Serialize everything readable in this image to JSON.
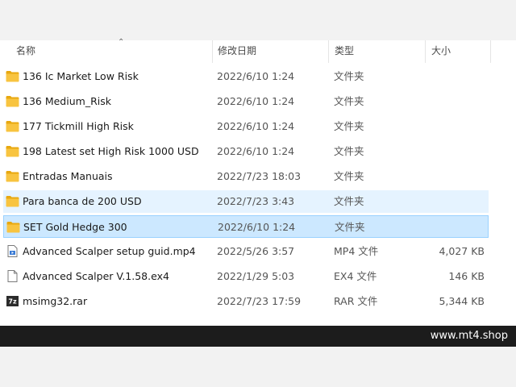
{
  "columns": {
    "name": "名称",
    "date": "修改日期",
    "type": "类型",
    "size": "大小"
  },
  "files": [
    {
      "name": "136 Ic Market Low Risk",
      "date": "2022/6/10 1:24",
      "type": "文件夹",
      "size": "",
      "icon": "folder-icon",
      "state": "normal"
    },
    {
      "name": "136 Medium_Risk",
      "date": "2022/6/10 1:24",
      "type": "文件夹",
      "size": "",
      "icon": "folder-icon",
      "state": "normal"
    },
    {
      "name": "177 Tickmill High Risk",
      "date": "2022/6/10 1:24",
      "type": "文件夹",
      "size": "",
      "icon": "folder-icon",
      "state": "normal"
    },
    {
      "name": "198 Latest set High Risk 1000 USD",
      "date": "2022/6/10 1:24",
      "type": "文件夹",
      "size": "",
      "icon": "folder-icon",
      "state": "normal"
    },
    {
      "name": "Entradas Manuais",
      "date": "2022/7/23 18:03",
      "type": "文件夹",
      "size": "",
      "icon": "folder-icon",
      "state": "normal"
    },
    {
      "name": "Para banca de 200 USD",
      "date": "2022/7/23 3:43",
      "type": "文件夹",
      "size": "",
      "icon": "folder-icon",
      "state": "hover"
    },
    {
      "name": "SET Gold Hedge 300",
      "date": "2022/6/10 1:24",
      "type": "文件夹",
      "size": "",
      "icon": "folder-icon",
      "state": "selected"
    },
    {
      "name": "Advanced Scalper setup guid.mp4",
      "date": "2022/5/26 3:57",
      "type": "MP4 文件",
      "size": "4,027 KB",
      "icon": "video-file-icon",
      "state": "normal"
    },
    {
      "name": "Advanced Scalper V.1.58.ex4",
      "date": "2022/1/29 5:03",
      "type": "EX4 文件",
      "size": "146 KB",
      "icon": "file-icon",
      "state": "normal"
    },
    {
      "name": "msimg32.rar",
      "date": "2022/7/23 17:59",
      "type": "RAR 文件",
      "size": "5,344 KB",
      "icon": "archive-icon",
      "state": "normal"
    }
  ],
  "watermark": "www.mt4.shop",
  "colors": {
    "folder": "#f8c440",
    "hover": "#e5f3ff",
    "selected": "#cce8ff",
    "selected_border": "#99d1ff"
  }
}
